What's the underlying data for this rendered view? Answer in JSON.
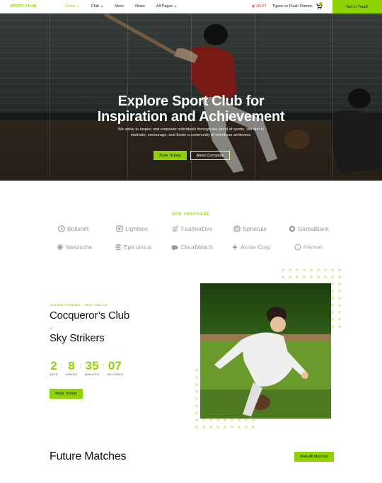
{
  "nav": {
    "logo": "SPORT CLUB",
    "menu": [
      "Home",
      "Club",
      "Store",
      "News",
      "All Pages"
    ],
    "ticker_label": "NEXT",
    "ticker_text": "Tigers vs Flash Flames",
    "cta": "Get in Touch"
  },
  "hero": {
    "title_line1": "Explore Sport Club for",
    "title_line2": "Inspiration and Achievement",
    "subtitle_line1": "We strive to inspire and empower individuals through the world of sports. We aim to",
    "subtitle_line2": "motivate, encourage, and foster a community of relentless achievers.",
    "btn_primary": "Book Tickets",
    "btn_secondary": "About Company"
  },
  "partners": {
    "label": "OUR PARTNERS",
    "row1": [
      "Boltshift",
      "Lightbox",
      "FeatherDev",
      "Spherule",
      "GlobalBank"
    ],
    "row2": [
      "Nietzsche",
      "Epicurious",
      "CloudWatch",
      "Acme Corp",
      "Polymath"
    ]
  },
  "match": {
    "kicker": "LEAGUE PREMIER • NEXT MATCH",
    "team1": "Cocqueror’s Club",
    "vs": "VS",
    "team2": "Sky Strikers",
    "countdown": [
      {
        "value": "2",
        "label": "DAYS"
      },
      {
        "value": "8",
        "label": "HOURS"
      },
      {
        "value": "35",
        "label": "MINUTES"
      },
      {
        "value": "07",
        "label": "SECONDS"
      }
    ],
    "btn": "Book Tickets"
  },
  "future": {
    "title": "Future Matches",
    "btn": "View All Matches"
  },
  "colors": {
    "accent": "#8fd400",
    "live": "#e6312a",
    "partner_gray": "#9a9a9a"
  }
}
